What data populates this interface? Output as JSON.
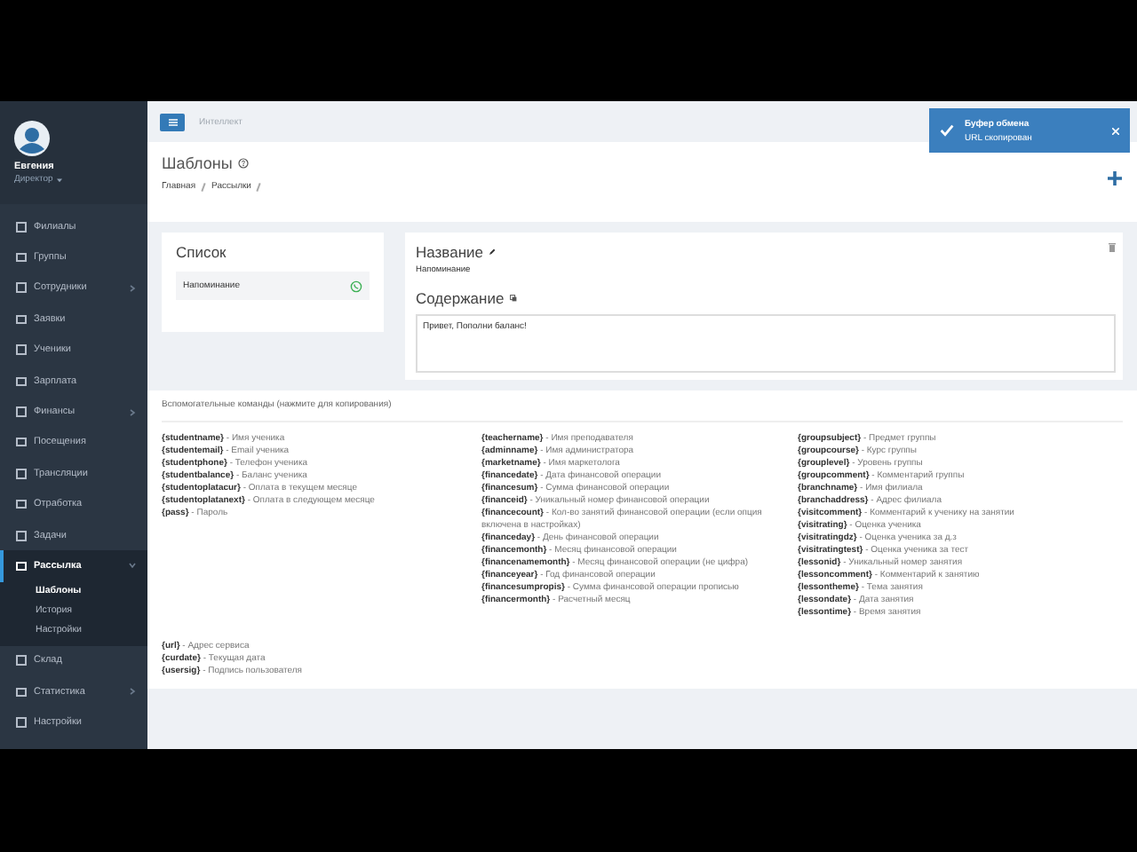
{
  "user": {
    "name": "Евгения",
    "role": "Директор"
  },
  "sidebar": {
    "items": [
      {
        "label": "Филиалы",
        "selected": false,
        "expandable": false
      },
      {
        "label": "Группы",
        "selected": false,
        "expandable": false
      },
      {
        "label": "Сотрудники",
        "selected": false,
        "expandable": true
      },
      {
        "label": "Заявки",
        "selected": false,
        "expandable": false
      },
      {
        "label": "Ученики",
        "selected": false,
        "expandable": false
      },
      {
        "label": "Зарплата",
        "selected": false,
        "expandable": false
      },
      {
        "label": "Финансы",
        "selected": false,
        "expandable": true
      },
      {
        "label": "Посещения",
        "selected": false,
        "expandable": false
      },
      {
        "label": "Трансляции",
        "selected": false,
        "expandable": false
      },
      {
        "label": "Отработка",
        "selected": false,
        "expandable": false
      },
      {
        "label": "Задачи",
        "selected": false,
        "expandable": false
      },
      {
        "label": "Рассылка",
        "selected": true,
        "expandable": true,
        "children": [
          {
            "label": "Шаблоны",
            "selected": true
          },
          {
            "label": "История",
            "selected": false
          },
          {
            "label": "Настройки",
            "selected": false
          }
        ]
      },
      {
        "label": "Склад",
        "selected": false,
        "expandable": false
      },
      {
        "label": "Статистика",
        "selected": false,
        "expandable": true
      },
      {
        "label": "Настройки",
        "selected": false,
        "expandable": false
      }
    ]
  },
  "topbar": {
    "title": "Интеллект"
  },
  "notification": {
    "title": "Буфер обмена",
    "message": "URL скопирован"
  },
  "page": {
    "title": "Шаблоны",
    "breadcrumbs": [
      "Главная",
      "Рассылки"
    ]
  },
  "list_panel": {
    "title": "Список",
    "items": [
      "Напоминание"
    ]
  },
  "editor": {
    "name_label": "Название",
    "name_value": "Напоминание",
    "content_label": "Содержание",
    "content_value": "Привет, Пополни баланс!"
  },
  "commands": {
    "title": "Вспомогательные команды (нажмите для копирования)",
    "columns": [
      [
        "**{studentname}** - Имя ученика",
        "**{studentemail}** - Email ученика",
        "**{studentphone}** - Телефон ученика",
        "**{studentbalance}** - Баланс ученика",
        "**{studentoplatacur}** - Оплата в текущем месяце",
        "**{studentoplatanext}** - Оплата в следующем месяце",
        "**{pass}** - Пароль"
      ],
      [
        "**{teachername}** - Имя преподавателя",
        "**{adminname}** - Имя администратора",
        "**{marketname}** - Имя маркетолога",
        "**{financedate}** - Дата финансовой операции",
        "**{financesum}** - Сумма финансовой операции",
        "**{financeid}** - Уникальный номер финансовой операции",
        "**{financecount}** - Кол-во занятий финансовой операции (если опция включена в настройках)",
        "**{financeday}** - День финансовой операции",
        "**{financemonth}** - Месяц финансовой операции",
        "**{financenamemonth}** - Месяц финансовой операции (не цифра)",
        "**{financeyear}** - Год финансовой операции",
        "**{financesumpropis}** - Сумма финансовой операции прописью",
        "**{financermonth}** - Расчетный месяц"
      ],
      [
        "**{groupsubject}** - Предмет группы",
        "**{groupcourse}** - Курс группы",
        "**{grouplevel}** - Уровень группы",
        "**{groupcomment}** - Комментарий группы",
        "**{branchname}** - Имя филиала",
        "**{branchaddress}** - Адрес филиала",
        "**{visitcomment}** - Комментарий к ученику на занятии",
        "**{visitrating}** - Оценка ученика",
        "**{visitratingdz}** - Оценка ученика за д.з",
        "**{visitratingtest}** - Оценка ученика за тест",
        "**{lessonid}** - Уникальный номер занятия",
        "**{lessoncomment}** - Комментарий к занятию",
        "**{lessontheme}** - Тема занятия",
        "**{lessondate}** - Дата занятия",
        "**{lessontime}** - Время занятия"
      ]
    ],
    "extra": [
      "**{url}** - Адрес сервиса",
      "**{curdate}** - Текущая дата",
      "**{usersig}** - Подпись пользователя"
    ]
  }
}
